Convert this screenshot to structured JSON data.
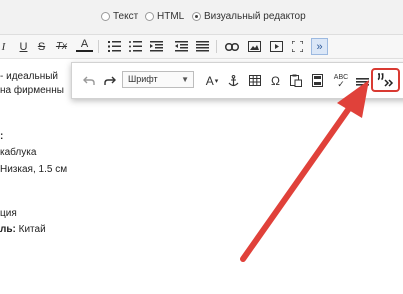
{
  "mode_selector": {
    "options": [
      "Текст",
      "HTML",
      "Визуальный редактор"
    ],
    "selected": "Визуальный редактор"
  },
  "toolbar": {
    "italic_glyph": "I",
    "underline_glyph": "U",
    "strike_glyph": "S",
    "clear_format_glyph": "Tx",
    "text_color_glyph": "A",
    "more_glyph": "»"
  },
  "popup_toolbar": {
    "font_select_value": "Шрифт",
    "font_size_glyph": "A",
    "special_char_glyph": "Ω",
    "spellcheck_glyph": "ABC"
  },
  "editor_lines": [
    {
      "text": "- идеальный"
    },
    {
      "text": "на фирменны"
    },
    {
      "text": ":"
    },
    {
      "text": "каблука"
    },
    {
      "text": "Низкая, 1.5 см"
    },
    {
      "text": "ция"
    },
    {
      "label": "ль:",
      "value": " Китай"
    }
  ],
  "colors": {
    "accent": "#d93a32",
    "active_button": "#dbe7f7"
  }
}
